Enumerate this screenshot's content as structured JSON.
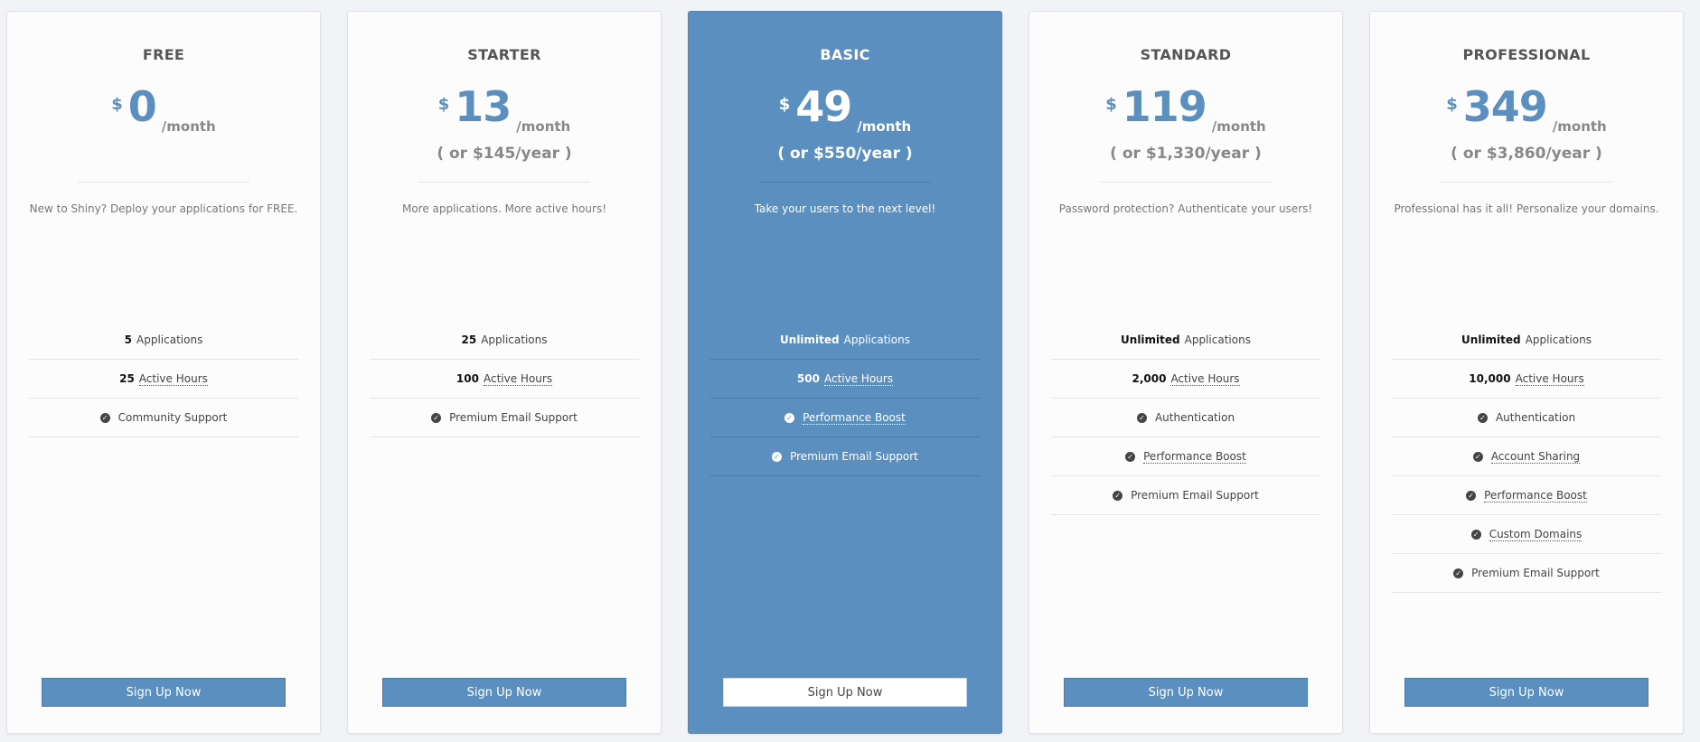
{
  "plans": [
    {
      "name": "FREE",
      "currency": "$",
      "amount": "0",
      "period": "/month",
      "yearly": "",
      "tagline": "New to Shiny? Deploy your applications for FREE.",
      "features": [
        {
          "bold": "5",
          "text": "Applications",
          "dotted": false,
          "check": false
        },
        {
          "bold": "25",
          "text": "Active Hours",
          "dotted": true,
          "check": false
        },
        {
          "bold": "",
          "text": "Community Support",
          "dotted": false,
          "check": true
        }
      ],
      "button": "Sign Up Now"
    },
    {
      "name": "STARTER",
      "currency": "$",
      "amount": "13",
      "period": "/month",
      "yearly": "( or $145/year )",
      "tagline": "More applications. More active hours!",
      "features": [
        {
          "bold": "25",
          "text": "Applications",
          "dotted": false,
          "check": false
        },
        {
          "bold": "100",
          "text": "Active Hours",
          "dotted": true,
          "check": false
        },
        {
          "bold": "",
          "text": "Premium Email Support",
          "dotted": false,
          "check": true
        }
      ],
      "button": "Sign Up Now"
    },
    {
      "name": "BASIC",
      "currency": "$",
      "amount": "49",
      "period": "/month",
      "yearly": "( or $550/year )",
      "tagline": "Take your users to the next level!",
      "featured": true,
      "features": [
        {
          "bold": "Unlimited",
          "text": "Applications",
          "dotted": false,
          "check": false
        },
        {
          "bold": "500",
          "text": "Active Hours",
          "dotted": true,
          "check": false
        },
        {
          "bold": "",
          "text": "Performance Boost",
          "dotted": true,
          "check": true
        },
        {
          "bold": "",
          "text": "Premium Email Support",
          "dotted": false,
          "check": true
        }
      ],
      "button": "Sign Up Now"
    },
    {
      "name": "STANDARD",
      "currency": "$",
      "amount": "119",
      "period": "/month",
      "yearly": "( or $1,330/year )",
      "tagline": "Password protection? Authenticate your users!",
      "features": [
        {
          "bold": "Unlimited",
          "text": "Applications",
          "dotted": false,
          "check": false
        },
        {
          "bold": "2,000",
          "text": "Active Hours",
          "dotted": true,
          "check": false
        },
        {
          "bold": "",
          "text": "Authentication",
          "dotted": false,
          "check": true
        },
        {
          "bold": "",
          "text": "Performance Boost",
          "dotted": true,
          "check": true
        },
        {
          "bold": "",
          "text": "Premium Email Support",
          "dotted": false,
          "check": true
        }
      ],
      "button": "Sign Up Now"
    },
    {
      "name": "PROFESSIONAL",
      "currency": "$",
      "amount": "349",
      "period": "/month",
      "yearly": "( or $3,860/year )",
      "tagline": "Professional has it all! Personalize your domains.",
      "features": [
        {
          "bold": "Unlimited",
          "text": "Applications",
          "dotted": false,
          "check": false
        },
        {
          "bold": "10,000",
          "text": "Active Hours",
          "dotted": true,
          "check": false
        },
        {
          "bold": "",
          "text": "Authentication",
          "dotted": false,
          "check": true
        },
        {
          "bold": "",
          "text": "Account Sharing",
          "dotted": true,
          "check": true
        },
        {
          "bold": "",
          "text": "Performance Boost",
          "dotted": true,
          "check": true
        },
        {
          "bold": "",
          "text": "Custom Domains",
          "dotted": true,
          "check": true
        },
        {
          "bold": "",
          "text": "Premium Email Support",
          "dotted": false,
          "check": true
        }
      ],
      "button": "Sign Up Now"
    }
  ],
  "colors": {
    "accent": "#5b8fbf",
    "background": "#f1f3f6",
    "card": "#fcfcfd"
  },
  "icons": {
    "feature_check": "check-circle-icon"
  }
}
